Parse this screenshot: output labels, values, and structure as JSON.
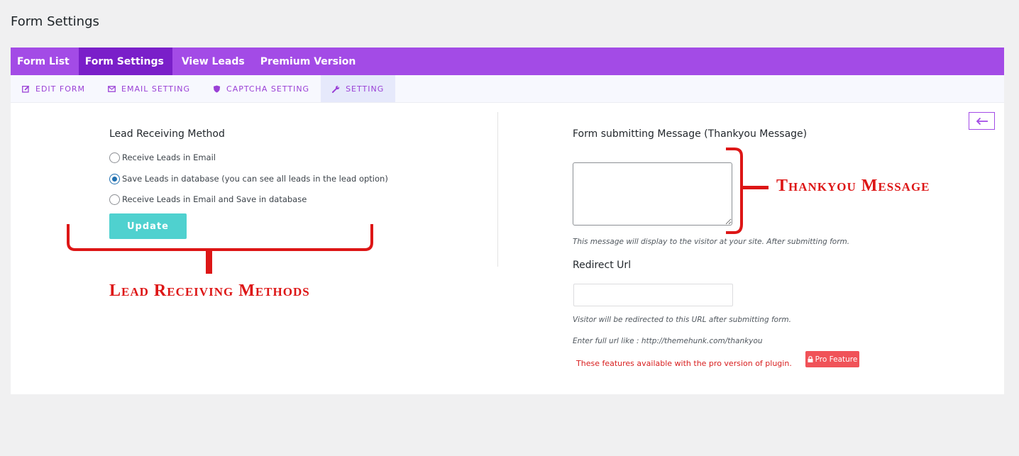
{
  "page_title": "Form Settings",
  "main_tabs": [
    {
      "label": "Form List"
    },
    {
      "label": "Form Settings"
    },
    {
      "label": "View Leads"
    },
    {
      "label": "Premium Version"
    }
  ],
  "sub_tabs": [
    {
      "label": "EDIT FORM",
      "icon": "edit-icon"
    },
    {
      "label": "EMAIL SETTING",
      "icon": "envelope-icon"
    },
    {
      "label": "CAPTCHA SETTING",
      "icon": "shield-icon"
    },
    {
      "label": "SETTING",
      "icon": "wrench-icon"
    }
  ],
  "lead_method": {
    "title": "Lead Receiving Method",
    "options": [
      {
        "label": "Receive Leads in Email",
        "checked": false
      },
      {
        "label": "Save Leads in database (you can see all leads in the lead option)",
        "checked": true
      },
      {
        "label": "Receive Leads in Email and Save in database",
        "checked": false
      }
    ],
    "update_label": "Update"
  },
  "thankyou": {
    "title": "Form submitting Message (Thankyou Message)",
    "value": "",
    "help": "This message will display to the visitor at your site. After submitting form."
  },
  "redirect": {
    "title": "Redirect Url",
    "value": "",
    "help1": "Visitor will be redirected to this URL after submitting form.",
    "help2": "Enter full url like : http://themehunk.com/thankyou"
  },
  "pro": {
    "note": "These features available with the pro version of plugin.",
    "badge": "Pro Feature"
  },
  "annotations": {
    "thankyou": "Thankyou Message",
    "lead": "Lead Receiving Methods"
  },
  "colors": {
    "accent": "#a34be6",
    "accent_dark": "#7a1fc9",
    "update_button": "#4fd1cf",
    "annotation_red": "#dd1616",
    "pro_badge": "#f05258"
  }
}
